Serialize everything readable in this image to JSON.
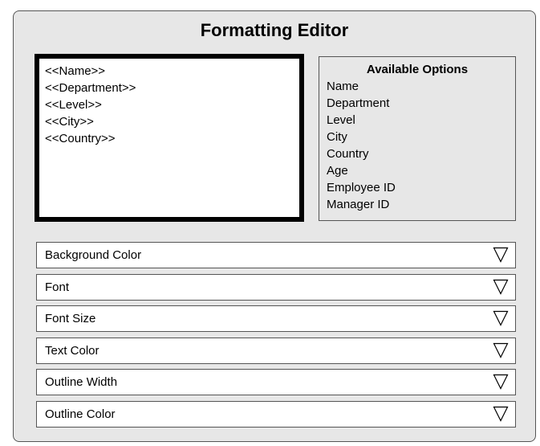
{
  "editor": {
    "title": "Formatting Editor"
  },
  "template": {
    "lines": [
      "<<Name>>",
      "<<Department>>",
      "<<Level>>",
      "<<City>>",
      "<<Country>>"
    ]
  },
  "options": {
    "title": "Available Options",
    "items": [
      "Name",
      "Department",
      "Level",
      "City",
      "Country",
      "Age",
      "Employee ID",
      "Manager ID"
    ]
  },
  "dropdowns": [
    {
      "label": "Background Color",
      "icon": "triangle-down-icon"
    },
    {
      "label": "Font",
      "icon": "triangle-down-icon"
    },
    {
      "label": "Font Size",
      "icon": "triangle-down-icon"
    },
    {
      "label": "Text Color",
      "icon": "triangle-down-icon"
    },
    {
      "label": "Outline Width",
      "icon": "triangle-down-icon"
    },
    {
      "label": "Outline Color",
      "icon": "triangle-down-icon"
    }
  ]
}
